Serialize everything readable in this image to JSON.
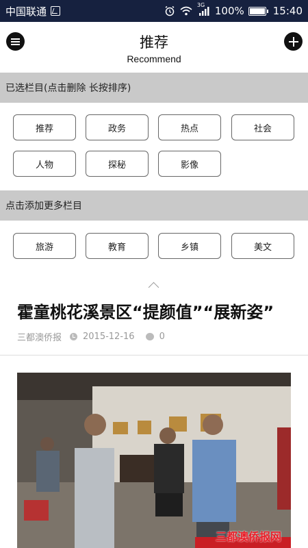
{
  "status_bar": {
    "carrier": "中国联通",
    "network": "3G",
    "battery": "100%",
    "battery_level": 1.0,
    "time": "15:40"
  },
  "header": {
    "title": "推荐",
    "subtitle": "Recommend"
  },
  "selected_section": {
    "label": "已选栏目(点击删除 长按排序)",
    "chips": [
      "推荐",
      "政务",
      "热点",
      "社会",
      "人物",
      "探秘",
      "影像"
    ]
  },
  "more_section": {
    "label": "点击添加更多栏目",
    "chips": [
      "旅游",
      "教育",
      "乡镇",
      "美文"
    ]
  },
  "article": {
    "title": "霍童桃花溪景区“提颜值”“展新姿”",
    "source": "三都澳侨报",
    "date": "2015-12-16",
    "comments": "0"
  },
  "photo": {
    "watermark": "三都澳侨报网"
  },
  "icons": {
    "menu": "menu-icon",
    "add": "plus-icon",
    "collapse": "chevron-up-icon",
    "clock": "clock-icon",
    "comment": "comment-icon",
    "sim": "sim-icon",
    "wifi": "wifi-icon",
    "signal": "signal-icon",
    "alarm": "alarm-icon",
    "battery": "battery-icon"
  }
}
